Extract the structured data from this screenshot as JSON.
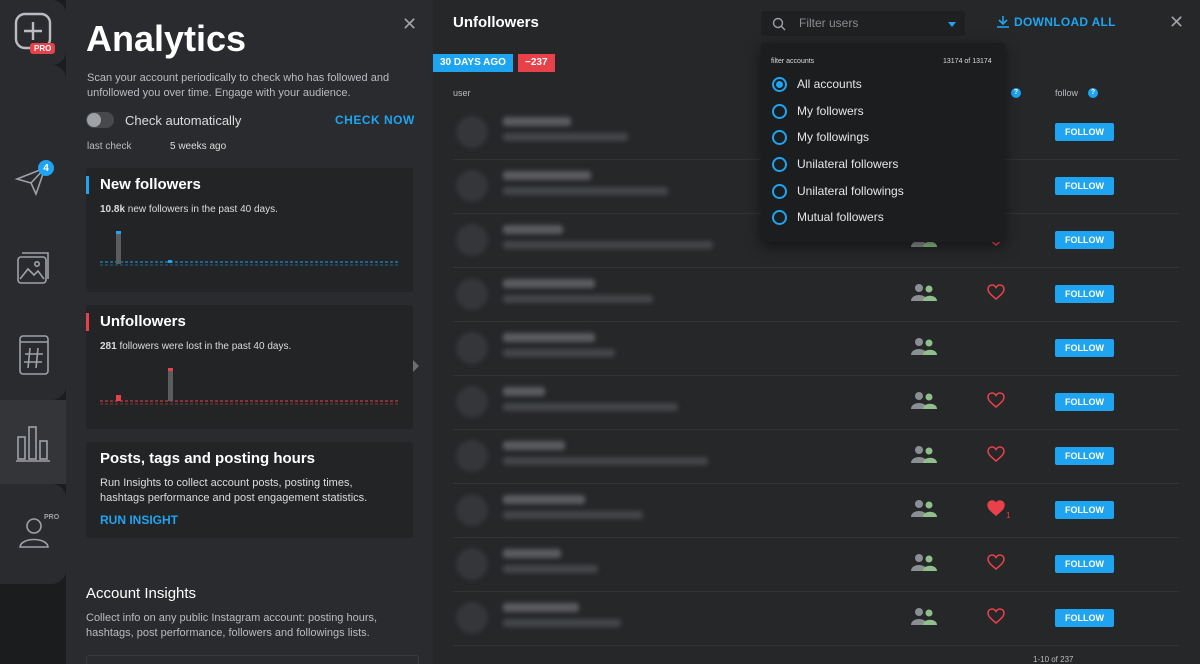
{
  "rail": {
    "pro_label": "PRO",
    "notification_count": "4",
    "profile_pro_label": "PRO"
  },
  "analytics": {
    "title": "Analytics",
    "intro": "Scan your account periodically to check who has followed and unfollowed you over time. Engage with your audience.",
    "check_auto_label": "Check automatically",
    "check_now": "CHECK NOW",
    "last_check_label": "last check",
    "last_check_value": "5 weeks ago",
    "new_followers": {
      "title": "New followers",
      "count": "10.8k",
      "desc": " new followers in the past 40 days.",
      "accent": "#1ea4f0"
    },
    "unfollowers": {
      "title": "Unfollowers",
      "count": "281",
      "desc": " followers were lost in the past 40 days.",
      "accent": "#e8414a"
    },
    "posts": {
      "title": "Posts, tags and posting hours",
      "desc": "Run Insights to collect account posts, posting times, hashtags performance and post engagement statistics.",
      "action": "RUN INSIGHT"
    },
    "account_insights": {
      "title": "Account Insights",
      "desc": "Collect info on any public Instagram account: posting hours, hashtags, post performance, followers and followings lists."
    }
  },
  "main": {
    "title": "Unfollowers",
    "filter_placeholder": "Filter users",
    "download_all": "DOWNLOAD ALL",
    "tag_days": "30 DAYS AGO",
    "tag_delta": "−237",
    "col_user": "user",
    "col_follow": "follow",
    "follow_label": "FOLLOW",
    "pager": "1-10 of 237",
    "rows": [
      {
        "frx": false,
        "heart": "none",
        "count": ""
      },
      {
        "frx": false,
        "heart": "outline",
        "count": ""
      },
      {
        "frx": true,
        "heart": "outline",
        "count": ""
      },
      {
        "frx": true,
        "heart": "outline",
        "count": ""
      },
      {
        "frx": true,
        "heart": "none",
        "count": ""
      },
      {
        "frx": true,
        "heart": "outline",
        "count": ""
      },
      {
        "frx": true,
        "heart": "outline",
        "count": ""
      },
      {
        "frx": true,
        "heart": "filled",
        "count": "1"
      },
      {
        "frx": true,
        "heart": "outline",
        "count": ""
      },
      {
        "frx": true,
        "heart": "outline",
        "count": ""
      }
    ]
  },
  "dropdown": {
    "label": "filter accounts",
    "count": "13174 of 13174",
    "options": [
      {
        "label": "All accounts",
        "selected": true
      },
      {
        "label": "My followers",
        "selected": false
      },
      {
        "label": "My followings",
        "selected": false
      },
      {
        "label": "Unilateral followers",
        "selected": false
      },
      {
        "label": "Unilateral followings",
        "selected": false
      },
      {
        "label": "Mutual followers",
        "selected": false
      }
    ]
  },
  "colors": {
    "accent": "#1ea4f0",
    "danger": "#e8414a",
    "friends": "#8a8f94"
  }
}
